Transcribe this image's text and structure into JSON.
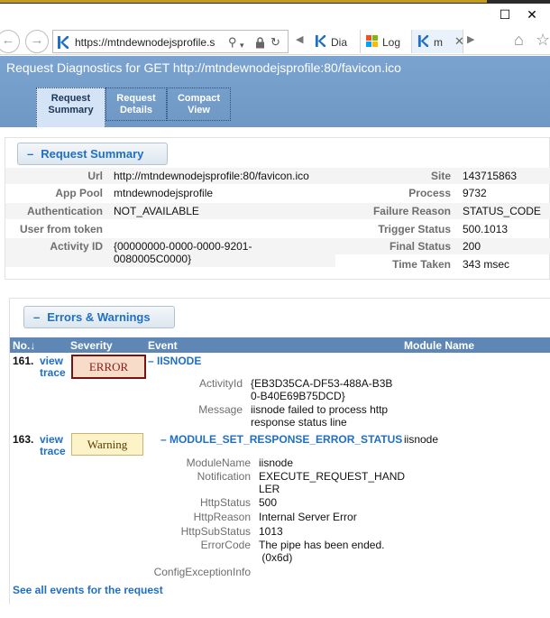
{
  "browser": {
    "address_url": "https://mtndewnodejsprofile.s",
    "tabs": [
      {
        "label": "Dia",
        "icon": "k-logo-icon"
      },
      {
        "label": "Log",
        "icon": "windows-logo-icon"
      },
      {
        "label": "m",
        "icon": "k-logo-icon",
        "active": true
      }
    ],
    "close_glyph": "✕",
    "maximize_glyph": "☐"
  },
  "page": {
    "title": "Request Diagnostics for GET http://mtndewnodejsprofile:80/favicon.ico",
    "tabs": [
      {
        "label_line1": "Request",
        "label_line2": "Summary",
        "selected": true
      },
      {
        "label_line1": "Request",
        "label_line2": "Details"
      },
      {
        "label_line1": "Compact",
        "label_line2": "View"
      }
    ]
  },
  "summary": {
    "section_title": "Request Summary",
    "toggle": "–",
    "left": [
      {
        "label": "Url",
        "value": "http://mtndewnodejsprofile:80/favicon.ico"
      },
      {
        "label": "App Pool",
        "value": "mtndewnodejsprofile"
      },
      {
        "label": "Authentication",
        "value": "NOT_AVAILABLE"
      },
      {
        "label": "User from token",
        "value": ""
      },
      {
        "label": "Activity ID",
        "value_line1": "{00000000-0000-0000-9201-",
        "value_line2": "0080005C0000}"
      }
    ],
    "right": [
      {
        "label": "Site",
        "value": "143715863"
      },
      {
        "label": "Process",
        "value": "9732"
      },
      {
        "label": "Failure Reason",
        "value": "STATUS_CODE"
      },
      {
        "label": "Trigger Status",
        "value": "500.1013"
      },
      {
        "label": "Final Status",
        "value": "200"
      },
      {
        "label": "Time Taken",
        "value": "343 msec"
      }
    ]
  },
  "errors": {
    "section_title": "Errors & Warnings",
    "toggle": "–",
    "columns": {
      "no": "No.↓",
      "severity": "Severity",
      "event": "Event",
      "module": "Module Name"
    },
    "rows": [
      {
        "no": "161.",
        "view1": "view",
        "view2": "trace",
        "severity": "ERROR",
        "event": "– IISNODE",
        "module": "",
        "fields": [
          {
            "label": "ActivityId",
            "line1": "{EB3D35CA-DF53-488A-B3B",
            "line2": "0-B40E69B75DCD}"
          },
          {
            "label": "Message",
            "line1": "iisnode failed to process http",
            "line2": "response status line"
          }
        ]
      },
      {
        "no": "163.",
        "view1": "view",
        "view2": "trace",
        "severity": "Warning",
        "event": "– MODULE_SET_RESPONSE_ERROR_STATUS",
        "module": "iisnode",
        "fields": [
          {
            "label": "ModuleName",
            "line1": "iisnode",
            "line2": ""
          },
          {
            "label": "Notification",
            "line1": "EXECUTE_REQUEST_HAND",
            "line2": "LER"
          },
          {
            "label": "HttpStatus",
            "line1": "500",
            "line2": ""
          },
          {
            "label": "HttpReason",
            "line1": "Internal Server Error",
            "line2": ""
          },
          {
            "label": "HttpSubStatus",
            "line1": "1013",
            "line2": ""
          },
          {
            "label": "ErrorCode",
            "line1": "The pipe has been ended.",
            "line2": " (0x6d)"
          },
          {
            "label": "ConfigExceptionInfo",
            "line1": "",
            "line2": ""
          }
        ]
      }
    ],
    "see_all": "See all events for the request"
  }
}
